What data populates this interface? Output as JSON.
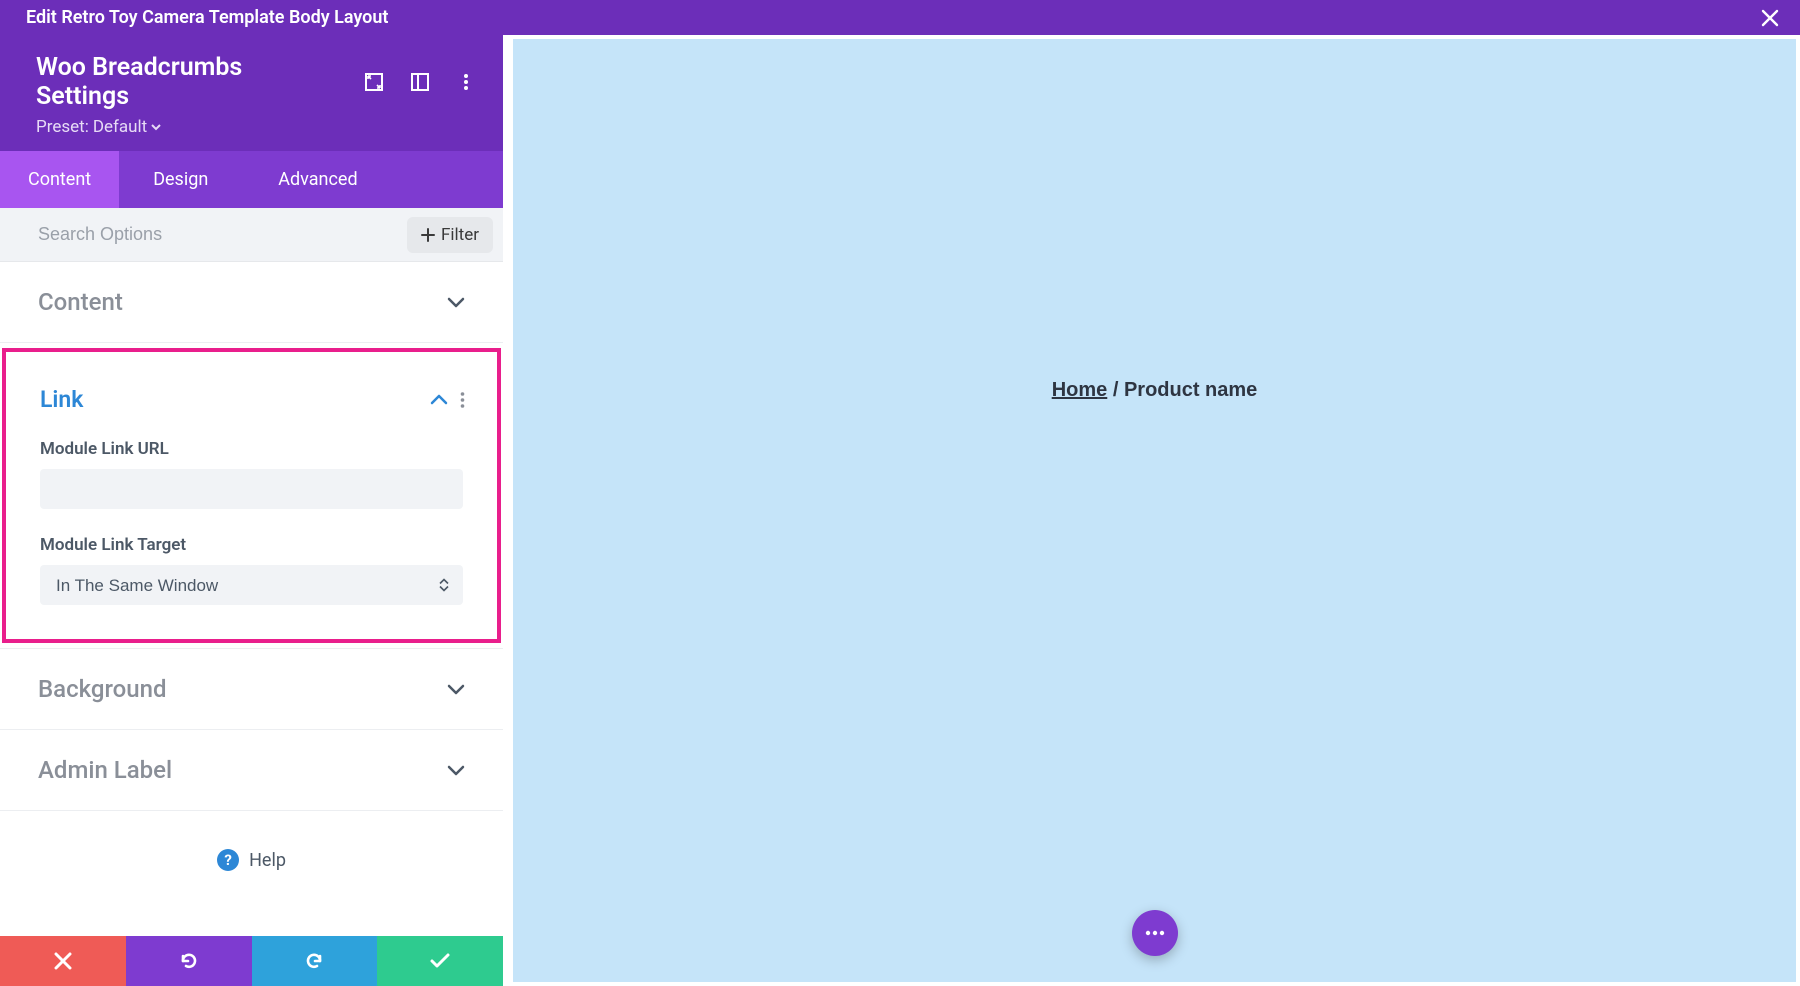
{
  "titlebar": {
    "title": "Edit Retro Toy Camera Template Body Layout"
  },
  "settings": {
    "title": "Woo Breadcrumbs Settings",
    "preset_prefix": "Preset:",
    "preset_value": "Default"
  },
  "tabs": {
    "content": "Content",
    "design": "Design",
    "advanced": "Advanced"
  },
  "search": {
    "placeholder": "Search Options",
    "filter_label": "Filter"
  },
  "sections": {
    "content": "Content",
    "link": {
      "title": "Link",
      "module_link_url_label": "Module Link URL",
      "module_link_url_value": "",
      "module_link_target_label": "Module Link Target",
      "module_link_target_value": "In The Same Window"
    },
    "background": "Background",
    "admin_label": "Admin Label"
  },
  "help_label": "Help",
  "preview": {
    "breadcrumb_home": "Home",
    "breadcrumb_sep": " / ",
    "breadcrumb_current": "Product name"
  },
  "colors": {
    "titlebar": "#6c2eb9",
    "tabs": "#7e3bd0",
    "tab_active": "#a855f0",
    "highlight": "#e91e8c",
    "canvas": "#c5e4f9"
  }
}
